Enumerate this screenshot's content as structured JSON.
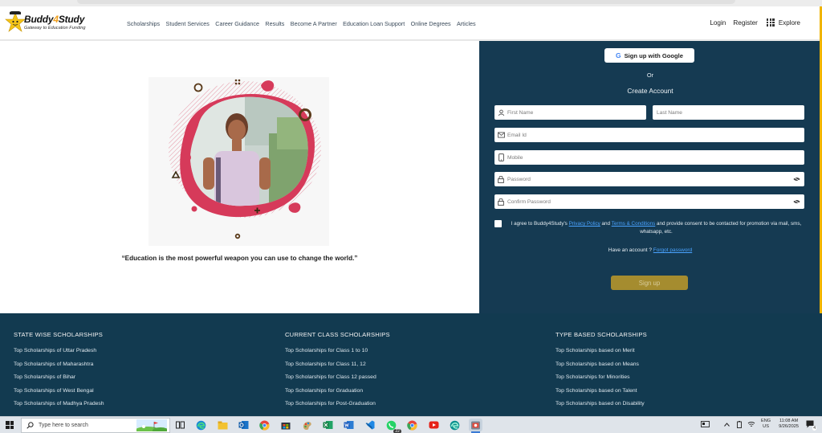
{
  "colors": {
    "panel": "#153a52",
    "footer": "#123a50",
    "signup_button": "#a58c2f",
    "link": "#4aa3ff",
    "accent_yellow": "#f0b400"
  },
  "header": {
    "logo_name_main": "Buddy",
    "logo_name_four": "4",
    "logo_name_tail": "Study",
    "logo_tagline": "Gateway to Education Funding",
    "nav": [
      "Scholarships",
      "Student Services",
      "Career Guidance",
      "Results",
      "Become A Partner",
      "Education Loan Support",
      "Online Degrees",
      "Articles"
    ],
    "login": "Login",
    "register": "Register",
    "explore": "Explore"
  },
  "hero": {
    "quote": "“Education is the most powerful weapon you can use to change the world.”"
  },
  "form": {
    "google_button": "Sign up with Google",
    "google_letter": "G",
    "or": "Or",
    "title": "Create Account",
    "first_name": "First Name",
    "last_name": "Last Name",
    "email": "Email Id",
    "mobile": "Mobile",
    "password": "Password",
    "confirm_password": "Confirm Password",
    "consent_prefix": "I agree to Buddy4Study's",
    "privacy_policy": "Privacy Policy",
    "and": "and",
    "terms": "Terms & Conditions",
    "consent_suffix": "and provide consent to be contacted for promotion via mail, sms, whatsapp, etc.",
    "have_account": "Have an account ?",
    "forgot_password": "Forgot password",
    "signup": "Sign up"
  },
  "footer": {
    "columns": [
      {
        "title": "STATE WISE SCHOLARSHIPS",
        "links": [
          "Top Scholarships of Uttar Pradesh",
          "Top Scholarships of Maharashtra",
          "Top Scholarships of Bihar",
          "Top Scholarships of West Bengal",
          "Top Scholarships of Madhya Pradesh"
        ]
      },
      {
        "title": "CURRENT CLASS SCHOLARSHIPS",
        "links": [
          "Top Scholarships for Class 1 to 10",
          "Top Scholarships for Class 11, 12",
          "Top Scholarships for Class 12 passed",
          "Top Scholarships for Graduation",
          "Top Scholarships for Post-Graduation"
        ]
      },
      {
        "title": "TYPE BASED SCHOLARSHIPS",
        "links": [
          "Top Scholarships based on Merit",
          "Top Scholarships based on Means",
          "Top Scholarships for Minorities",
          "Top Scholarships based on Talent",
          "Top Scholarships based on Disability"
        ]
      }
    ]
  },
  "taskbar": {
    "search_placeholder": "Type here to search",
    "whatsapp_badge": "22",
    "language_top": "ENG",
    "language_bottom": "US",
    "time": "11:08 AM",
    "date": "9/26/2025",
    "notifications": "4"
  }
}
